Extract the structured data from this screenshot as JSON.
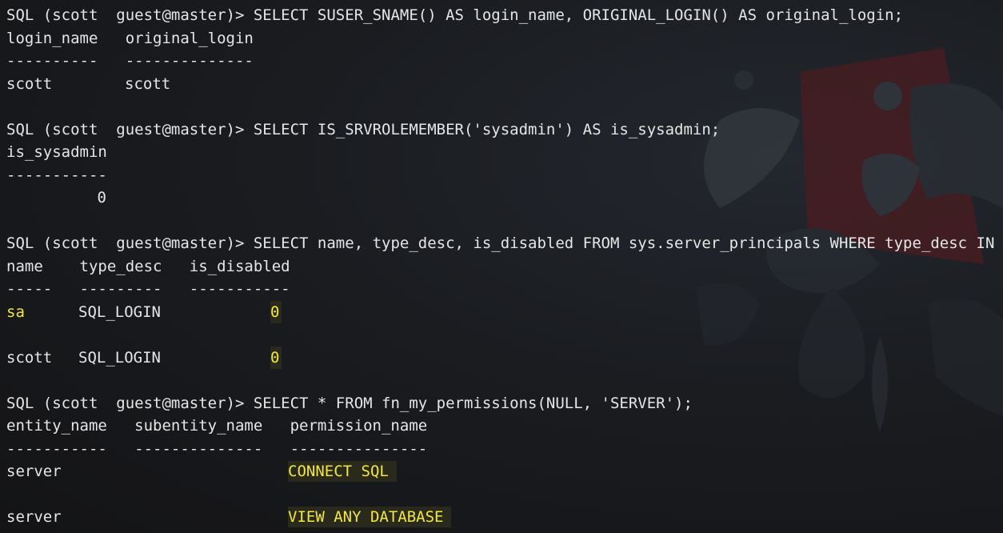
{
  "terminal": {
    "prompt": "SQL (scott  guest@master)> ",
    "q1": {
      "command": "SELECT SUSER_SNAME() AS login_name, ORIGINAL_LOGIN() AS original_login;",
      "header": "login_name   original_login",
      "sep": "----------   --------------",
      "rows": [
        [
          "scott",
          "scott"
        ]
      ]
    },
    "q2": {
      "command": "SELECT IS_SRVROLEMEMBER('sysadmin') AS is_sysadmin;",
      "header": "is_sysadmin",
      "sep": "-----------",
      "value": "0"
    },
    "q3": {
      "command": "SELECT name, type_desc, is_disabled FROM sys.server_principals WHERE type_desc IN (",
      "header": "name    type_desc   is_disabled",
      "sep": "-----   ---------   -----------",
      "rows": [
        {
          "name": "sa",
          "type_desc": "SQL_LOGIN",
          "is_disabled": "0"
        },
        {
          "name": "scott",
          "type_desc": "SQL_LOGIN",
          "is_disabled": "0"
        }
      ]
    },
    "q4": {
      "command": "SELECT * FROM fn_my_permissions(NULL, 'SERVER');",
      "header": "entity_name   subentity_name   permission_name",
      "sep": "-----------   --------------   ---------------",
      "rows": [
        {
          "entity_name": "server",
          "permission_name": "CONNECT SQL"
        },
        {
          "entity_name": "server",
          "permission_name": "VIEW ANY DATABASE"
        }
      ]
    }
  },
  "colors": {
    "background": "#141416",
    "text": "#e6e6e6",
    "highlight_text": "#f2e640",
    "highlight_bg": "#2a2a1c",
    "wallpaper_red": "#5a1a1e"
  }
}
